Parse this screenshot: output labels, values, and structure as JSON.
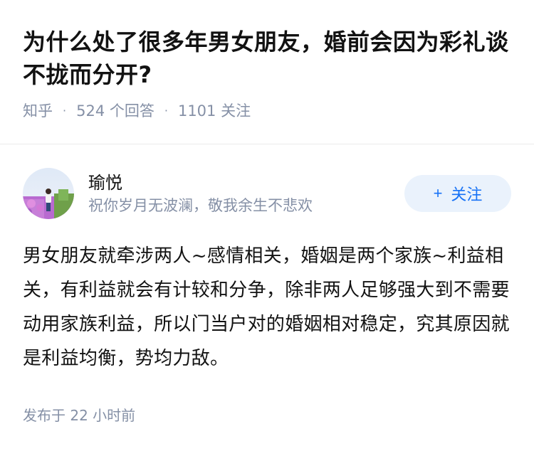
{
  "question": {
    "title": "为什么处了很多年男女朋友，婚前会因为彩礼谈不拢而分开?",
    "source": "知乎",
    "answer_count": "524 个回答",
    "follower_count": "1101 关注",
    "separator": "·"
  },
  "answer": {
    "author_name": "瑜悦",
    "author_bio": "祝你岁月无波澜，敬我余生不悲欢",
    "follow_label": "关注",
    "follow_icon": "+",
    "body": "男女朋友就牵涉两人~感情相关，婚姻是两个家族~利益相关，有利益就会有计较和分争，除非两人足够强大到不需要动用家族利益，所以门当户对的婚姻相对稳定，究其原因就是利益均衡，势均力敌。",
    "published": "发布于  22 小时前"
  },
  "colors": {
    "accent": "#1772f6",
    "follow_bg": "#eaf2fc",
    "meta_text": "#8590a6",
    "main_text": "#121212"
  }
}
